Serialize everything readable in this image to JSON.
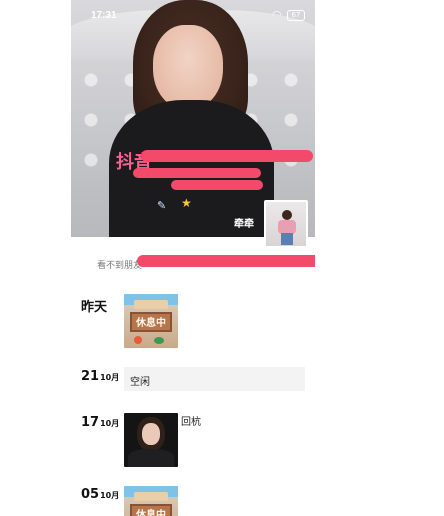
{
  "status_bar": {
    "time": "17:31",
    "battery": "67"
  },
  "cover": {
    "pink_overlay_text": "抖音",
    "nickname": "牵牵"
  },
  "notice": {
    "text": "看不到朋友"
  },
  "timeline": [
    {
      "day": "昨天",
      "month": ""
    },
    {
      "day": "21",
      "month": "10月",
      "text": "空闲"
    },
    {
      "day": "17",
      "month": "10月",
      "caption": "回杭"
    },
    {
      "day": "05",
      "month": "10月"
    }
  ],
  "sign_text": "休息中",
  "colors": {
    "redaction": "#f34a6b",
    "pink_text": "#ff5d8f",
    "card_bg": "#f3f3f3"
  }
}
